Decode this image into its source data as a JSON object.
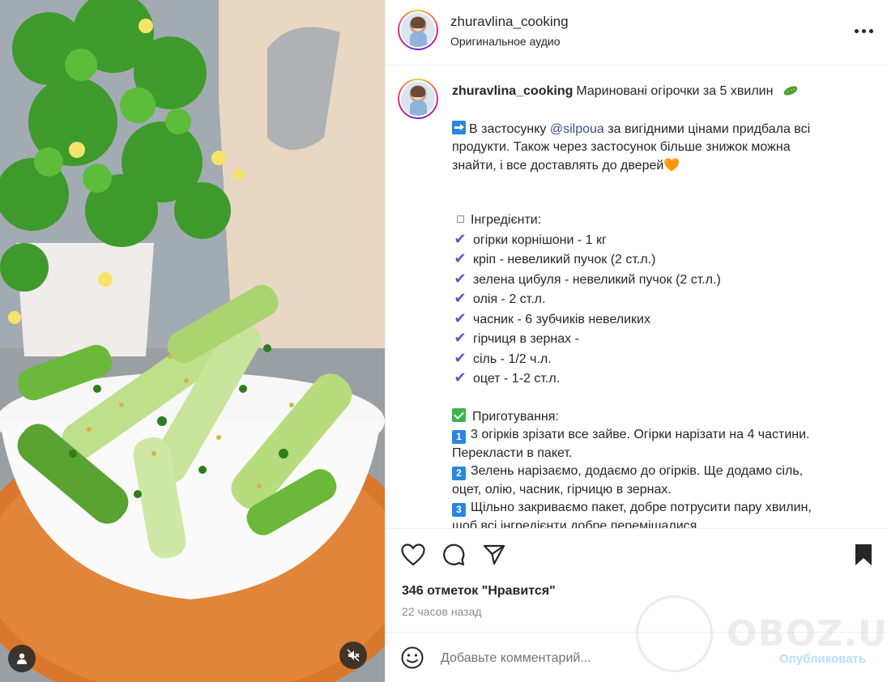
{
  "post": {
    "username": "zhuravlina_cooking",
    "audio_label": "Оригинальное аудио"
  },
  "caption": {
    "username": "zhuravlina_cooking",
    "title": "Мариновані огірочки за 5 хвилин",
    "intro": [
      {
        "before": "В застосунку ",
        "mention": "@silpoua",
        "after": " за вигідними цінами придбала всі"
      },
      {
        "text": "продукти. Також через застосунок більше знижок можна"
      },
      {
        "text": "знайти, і все доставлять до дверей",
        "emoji": "🧡"
      }
    ],
    "ingredients_title": "Інгредієнти:",
    "ingredients": [
      "огірки корнішони - 1 кг",
      "кріп - невеликий пучок (2 ст.л.)",
      "зелена цибуля - невеликий пучок (2 ст.л.)",
      "олія - 2 ст.л.",
      "часник - 6 зубчиків невеликих",
      "гірчиця в зернах -",
      "сіль - 1/2 ч.л.",
      "оцет - 1-2 ст.л."
    ],
    "preparation_title": "Приготування:",
    "steps": [
      {
        "num": "1",
        "lines": [
          "3 огірків зрізати все зайве. Огірки нарізати на 4 частини.",
          "Перекласти в пакет."
        ]
      },
      {
        "num": "2",
        "lines": [
          "Зелень нарізаємо, додаємо до огірків. Ще додамо сіль,",
          "оцет, олію, часник, гірчицю в зернах."
        ]
      },
      {
        "num": "3",
        "lines": [
          "Щільно закриваємо пакет, добре потрусити пару хвилин,",
          "щоб всі інгредієнти добре перемішалися."
        ]
      }
    ]
  },
  "stats": {
    "likes": "346 отметок \"Нравится\"",
    "time": "22 часов назад"
  },
  "comment": {
    "placeholder": "Добавьте комментарий...",
    "publish_label": "Опубликовать"
  },
  "watermark": "OBOZ.UA",
  "icons": {
    "like": "heart-icon",
    "comment": "comment-icon",
    "share": "send-icon",
    "save": "bookmark-icon",
    "emoji": "smiley-icon",
    "mute": "speaker-muted-icon",
    "user_tag": "user-icon",
    "more": "more-dots-icon"
  },
  "colors": {
    "accent_tick": "#6a4fc9",
    "mention": "#385185",
    "publish": "#b2dffc",
    "number_badge": "#2a86e0",
    "check_badge": "#3bb54a"
  }
}
